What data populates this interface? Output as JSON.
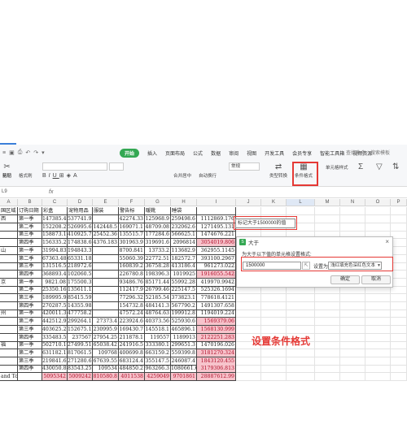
{
  "ribbon": {
    "tabs": [
      "开始",
      "插入",
      "页面布局",
      "公式",
      "数据",
      "审阅",
      "视图",
      "开发工具",
      "会员专享",
      "智能工具箱",
      "视频资源"
    ],
    "active_tab": "开始",
    "search_placeholder": "查找命令、搜索模板",
    "tools": {
      "cut": "剪切",
      "paste": "粘贴",
      "format_painter": "格式刷",
      "merge_center": "合并居中",
      "auto_wrap": "自动换行",
      "number_format": "常规",
      "type_convert": "类型转换",
      "conditional_format": "条件格式",
      "cell_style": "单元格样式"
    }
  },
  "formula_bar": {
    "name_box": "L9",
    "fx": "fx"
  },
  "sheet": {
    "columns": [
      "A",
      "B",
      "C",
      "D",
      "E",
      "F",
      "G",
      "H",
      "I",
      "J",
      "K",
      "L",
      "M",
      "N",
      "O",
      "P"
    ],
    "header_row": [
      "国区域",
      "订购日期",
      "彩盒",
      "宠物用品",
      "服装",
      "警告标",
      "暖靴",
      "睡袋",
      ""
    ],
    "rows": [
      [
        "西",
        "第一季",
        "147385.4",
        "537741.9",
        "",
        "42274.33",
        "125968.9",
        "259498.6",
        "1112869.176"
      ],
      [
        "",
        "第二季",
        "152208.2",
        "526995.6",
        "142448.5",
        "169071.1",
        "48709.08",
        "232062.6",
        "1271495.131"
      ],
      [
        "",
        "第三季",
        "158873.1",
        "410925.7",
        "25452.36",
        "135515.7",
        "177284.6",
        "566625.1",
        "1474676.221"
      ],
      [
        "",
        "第四季",
        "156335.2",
        "174838.6",
        "4376.183",
        "301963.9",
        "319691.6",
        "2096814",
        "3054019.806"
      ],
      [
        "山",
        "第一季",
        "31994.83",
        "194843.3",
        "",
        "8700.841",
        "13733.2",
        "113682.9",
        "362955.1145"
      ],
      [
        "",
        "第二季",
        "67363.48",
        "65331.18",
        "",
        "55060.39",
        "22772.51",
        "182572.7",
        "393100.2967"
      ],
      [
        "",
        "第三季",
        "131516.5",
        "218972.6",
        "",
        "160839.2",
        "36758.28",
        "413186.4",
        "961273.022"
      ],
      [
        "",
        "第四季",
        "368893.4",
        "102060.5",
        "",
        "226780.8",
        "198396.3",
        "1019925",
        "1916055.542"
      ],
      [
        "京",
        "第一季",
        "9821.08",
        "175500.3",
        "",
        "93486.76",
        "85171.44",
        "55992.28",
        "419970.9942"
      ],
      [
        "",
        "第二季",
        "25350.16",
        "135611.1",
        "",
        "112417.9",
        "26799.46",
        "225147.5",
        "525326.1694"
      ],
      [
        "",
        "第三季",
        "189995.9",
        "85415.59",
        "",
        "77296.32",
        "52185.54",
        "373823.1",
        "778618.4121"
      ],
      [
        "",
        "第四季",
        "270287.5",
        "14355.98",
        "",
        "154732.8",
        "484141.3",
        "567790.2",
        "1491307.658"
      ],
      [
        "州",
        "第一季",
        "420011.3",
        "477758.2",
        "",
        "47572.24",
        "48764.63",
        "199912.8",
        "1194019.224"
      ],
      [
        "",
        "第二季",
        "442512.9",
        "299264.1",
        "27373.4",
        "223924.6",
        "40373.56",
        "525930.6",
        "1569379.06"
      ],
      [
        "",
        "第三季",
        "403625.2",
        "152675.1",
        "230995.9",
        "169430.7",
        "145518.1",
        "465896.1",
        "1568130.999"
      ],
      [
        "",
        "第四季",
        "335483.5",
        "237567",
        "27954.25",
        "211878.1",
        "119557",
        "1189913",
        "2122251.283"
      ],
      [
        "福",
        "第一季",
        "502710.1",
        "27499.51",
        "65038.42",
        "241916.5",
        "333380.1",
        "299651.3",
        "1470196.026"
      ],
      [
        "",
        "第二季",
        "631182.1",
        "817061.5",
        "109768",
        "400699.8",
        "663159.2",
        "559399.8",
        "3181270.324"
      ],
      [
        "",
        "第三季",
        "219841.6",
        "271280.6",
        "67639.55",
        "683124.4",
        "355147.5",
        "246087.4",
        "1843120.455"
      ],
      [
        "",
        "第四季",
        "430050.8",
        "83543.25",
        "109534",
        "484850.2",
        "963266.3",
        "1080661.6",
        "3179306.813"
      ],
      [
        "and Total",
        "",
        "5095342",
        "5009242",
        "810580.8",
        "4011538",
        "4259049",
        "9701861",
        "28887612.99"
      ]
    ]
  },
  "tooltip": {
    "text": "标记大于1500000的值"
  },
  "dialog": {
    "title": "大于",
    "prompt": "为大于以下值的单元格设置格式:",
    "value": "1500000",
    "set_label": "设置为",
    "format_option": "浅红填充色深红色文本",
    "ok_label": "确定",
    "cancel_label": "取消",
    "close_glyph": "×",
    "ref_glyph": "⇱"
  },
  "annotation": {
    "text": "设置条件格式"
  },
  "colors": {
    "highlight_fill": "#f7c4cc",
    "highlight_text": "#b0102b",
    "accent_red": "#e53935",
    "tab_green": "#34a853"
  }
}
